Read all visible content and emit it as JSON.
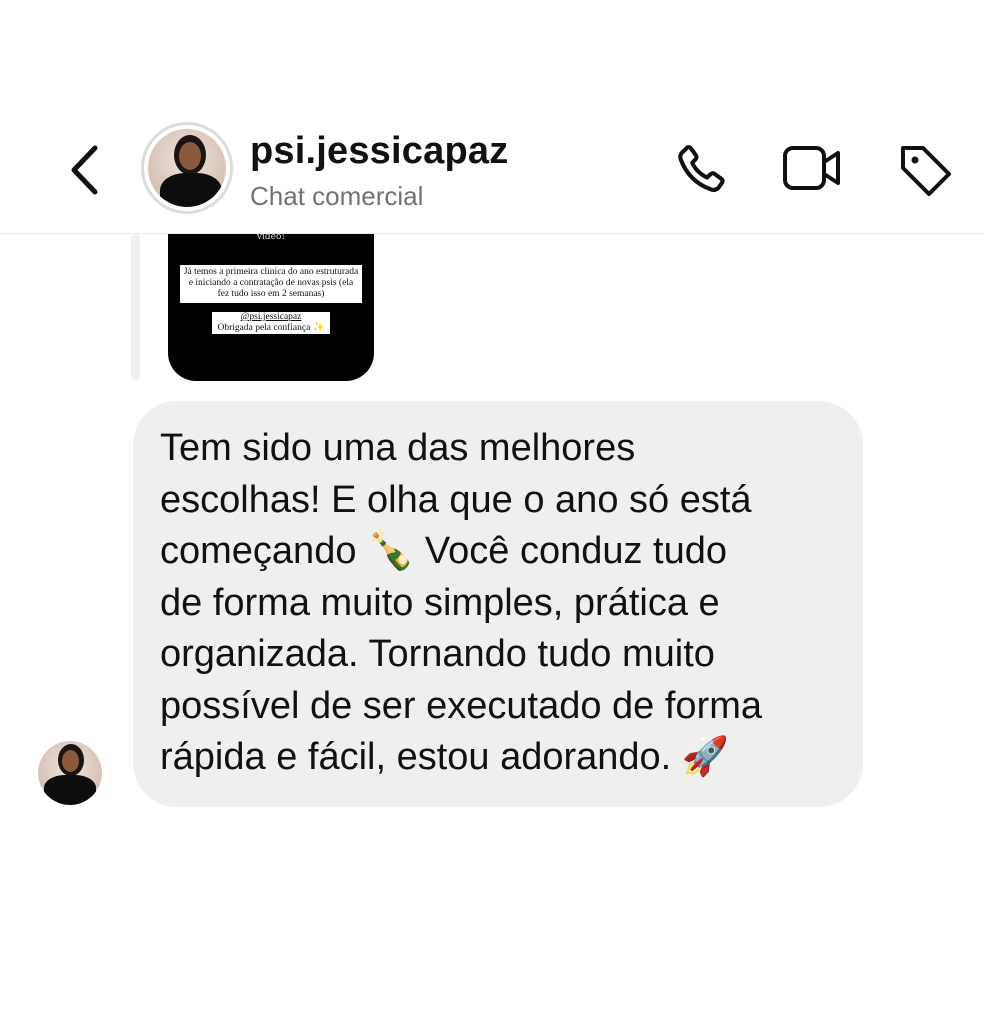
{
  "header": {
    "username": "psi.jessicapaz",
    "subtitle": "Chat comercial",
    "icons": [
      "back-icon",
      "phone-icon",
      "video-camera-icon",
      "tag-icon"
    ]
  },
  "shared_story": {
    "top_text": "vídeo!",
    "box1": "Já temos a primeira clínica do ano estruturada e iniciando a contratação de novas psis (ela fez tudo isso em 2 semanas)",
    "box2_handle": "@psi.jessicapaz",
    "box2_text": "Obrigada pela confiança ✨"
  },
  "message": {
    "lines": [
      "Tem sido uma das melhores",
      "escolhas! E olha que o ano só está",
      "começando 🍾 Você conduz tudo",
      "de forma muito simples, prática e",
      "organizada. Tornando tudo muito",
      "possível de ser executado de forma",
      "rápida e fácil, estou adorando. 🚀"
    ]
  },
  "colors": {
    "bubble": "#efefef",
    "subtitle": "#737373",
    "text": "#111111"
  }
}
